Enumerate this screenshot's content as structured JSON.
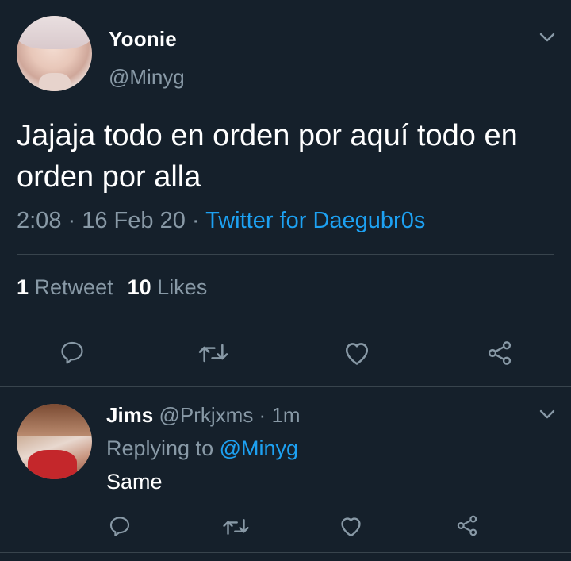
{
  "tweet": {
    "name": "Yoonie",
    "handle": "@Minyg",
    "text": "Jajaja todo en orden por aquí todo en orden por alla",
    "time": "2:08",
    "dot1": " · ",
    "date": "16 Feb 20",
    "dot2": " · ",
    "source": "Twitter for Daegubr0s",
    "retweet_count": "1",
    "retweet_label": "Retweet",
    "like_count": "10",
    "like_label": "Likes"
  },
  "reply": {
    "name": "Jims",
    "handle": "@Prkjxms",
    "dot": " · ",
    "time": "1m",
    "replying_prefix": "Replying to ",
    "replying_to": "@Minyg",
    "text": "Same"
  },
  "icons": {
    "reply": "reply-icon",
    "retweet": "retweet-icon",
    "like": "heart-icon",
    "share": "share-icon",
    "menu": "chevron-down-icon"
  },
  "colors": {
    "background": "#15202b",
    "secondary_text": "#8899a6",
    "accent": "#1da1f2",
    "divider": "#38444d"
  }
}
